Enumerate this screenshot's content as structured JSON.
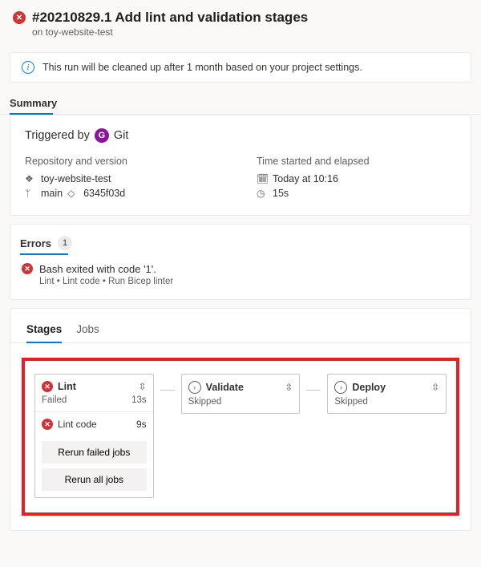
{
  "header": {
    "title": "#20210829.1 Add lint and validation stages",
    "subtitle": "on toy-website-test"
  },
  "banner": {
    "text": "This run will be cleaned up after 1 month based on your project settings."
  },
  "summary": {
    "label": "Summary",
    "triggered_prefix": "Triggered by",
    "avatar_letter": "G",
    "triggered_by": "Git",
    "repo_head": "Repository and version",
    "repo_name": "toy-website-test",
    "branch": "main",
    "commit": "6345f03d",
    "time_head": "Time started and elapsed",
    "started": "Today at 10:16",
    "elapsed": "15s"
  },
  "errors": {
    "label": "Errors",
    "count": "1",
    "items": [
      {
        "msg": "Bash exited with code '1'.",
        "path": "Lint • Lint code • Run Bicep linter"
      }
    ]
  },
  "stages_section": {
    "tab_stages": "Stages",
    "tab_jobs": "Jobs",
    "stages": [
      {
        "name": "Lint",
        "status": "Failed",
        "duration": "13s",
        "icon": "error",
        "jobs": [
          {
            "name": "Lint code",
            "duration": "9s",
            "icon": "error"
          }
        ],
        "btn_rerun_failed": "Rerun failed jobs",
        "btn_rerun_all": "Rerun all jobs"
      },
      {
        "name": "Validate",
        "status": "Skipped",
        "icon": "skip"
      },
      {
        "name": "Deploy",
        "status": "Skipped",
        "icon": "skip"
      }
    ]
  }
}
